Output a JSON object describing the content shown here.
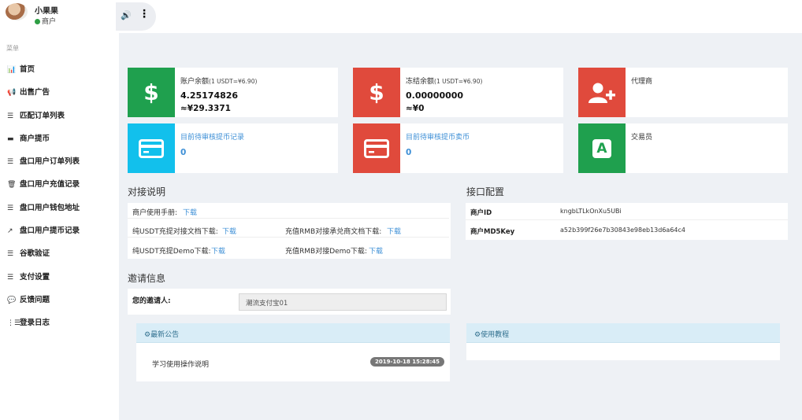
{
  "user": {
    "name": "小果果",
    "role": "商户"
  },
  "sidebar": {
    "label": "菜单",
    "items": [
      {
        "icon": "📊",
        "label": "首页"
      },
      {
        "icon": "📢",
        "label": "出售广告"
      },
      {
        "icon": "☰",
        "label": "匹配订单列表"
      },
      {
        "icon": "▬",
        "label": "商户提币"
      },
      {
        "icon": "☰",
        "label": "盘口用户订单列表"
      },
      {
        "icon": "🗑",
        "label": "盘口用户充值记录"
      },
      {
        "icon": "☰",
        "label": "盘口用户钱包地址"
      },
      {
        "icon": "↗",
        "label": "盘口用户提币记录"
      },
      {
        "icon": "☰",
        "label": "谷歌验证"
      },
      {
        "icon": "☰",
        "label": "支付设置"
      },
      {
        "icon": "💬",
        "label": "反馈问题"
      },
      {
        "icon": "⋮☰",
        "label": "登录日志"
      }
    ]
  },
  "topbar": {
    "speaker_glyph": "🔊",
    "more_glyph": "⋮"
  },
  "cards": {
    "balance": {
      "label": "账户余额",
      "rate": "(1 USDT=¥6.90)",
      "value": "4.25174826",
      "cny": "≈¥29.3371",
      "glyph": "$"
    },
    "frozen": {
      "label": "冻结余额",
      "rate": "(1 USDT=¥6.90)",
      "value": "0.00000000",
      "cny": "≈¥0",
      "glyph": "$"
    },
    "agent": {
      "label": "代理商"
    },
    "pending_withdraw": {
      "label": "目前待审核提币记录",
      "value": "0"
    },
    "pending_sell": {
      "label": "目前待审核提币卖币",
      "value": "0"
    },
    "trader": {
      "label": "交易员",
      "glyph": "A"
    }
  },
  "docs": {
    "title": "对接说明",
    "manual": "商户使用手册:",
    "usdt_doc": "纯USDT充提对接文档下载:",
    "rmb_doc": "充值RMB对接承兑商文档下载:",
    "usdt_demo": "纯USDT充提Demo下载:",
    "rmb_demo": "充值RMB对接Demo下载:",
    "download": "下载"
  },
  "api": {
    "title": "接口配置",
    "merchant_id_label": "商户ID",
    "merchant_id": "kngbLTLkOnXu5UBi",
    "md5_label": "商户MD5Key",
    "md5": "a52b399f26e7b30843e98eb13d6a64c4"
  },
  "invite": {
    "title": "邀请信息",
    "label": "您的邀请人:",
    "value": "潮流支付宝01"
  },
  "notice": {
    "title": "最新公告",
    "item": "学习使用操作说明",
    "time": "2019-10-18 15:28:45"
  },
  "tutorial": {
    "title": "使用教程"
  },
  "colors": {
    "green": "#1fa04e",
    "red": "#e04a3c",
    "cyan": "#12c0ec",
    "link": "#3d8fd6"
  }
}
